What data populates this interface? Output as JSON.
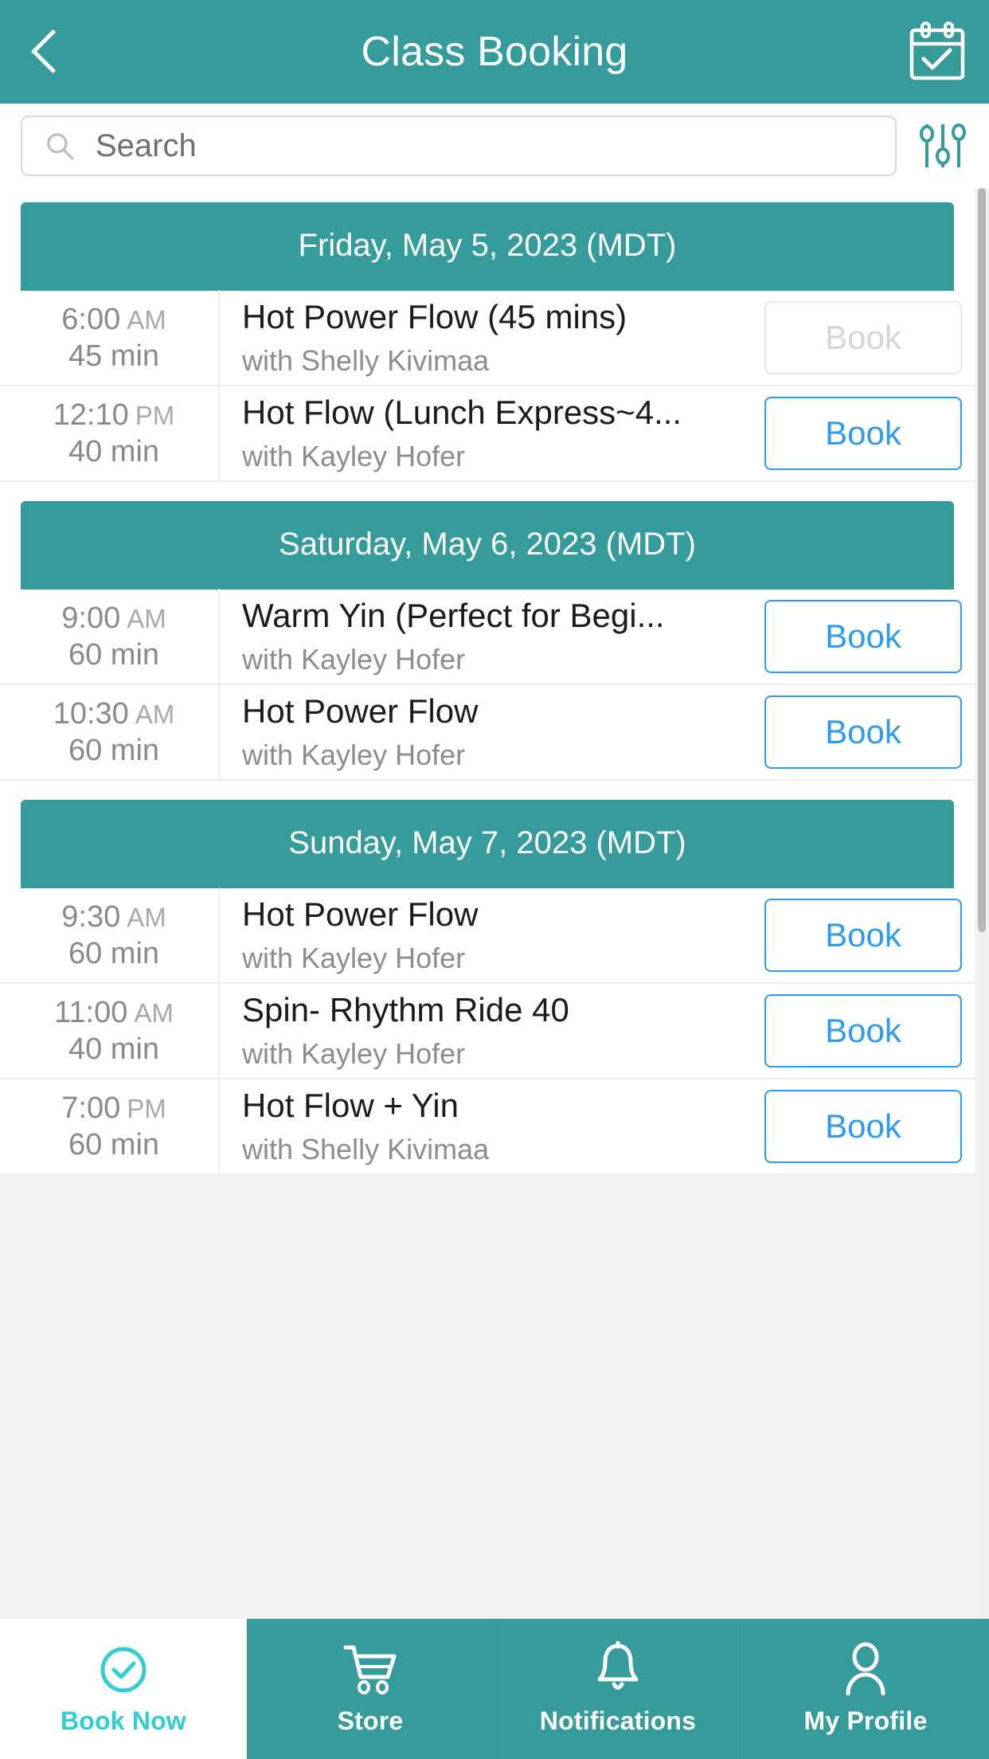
{
  "header": {
    "back_icon": "chevron-left-icon",
    "title": "Class Booking",
    "calendar_icon": "calendar-check-icon",
    "bg_color": "#359b9b"
  },
  "search": {
    "icon": "search-icon",
    "placeholder": "Search",
    "value": "",
    "filter_icon": "filter-sliders-icon",
    "filter_color": "#359b9b"
  },
  "colors": {
    "teal": "#359b9b",
    "book_blue": "#2e9bf0",
    "book_disabled": "#d5d5d5",
    "active_tab": "#32cdd2",
    "page_bg": "#f1f1f1"
  },
  "schedule": [
    {
      "date_label": "Friday, May 5, 2023 (MDT)",
      "classes": [
        {
          "time": "6:00",
          "ampm": "AM",
          "duration": "45 min",
          "name": "Hot Power Flow (45 mins)",
          "teacher": "with Shelly Kivimaa",
          "book_label": "Book",
          "bookable": false
        },
        {
          "time": "12:10",
          "ampm": "PM",
          "duration": "40 min",
          "name": "Hot Flow (Lunch Express~4...",
          "teacher": "with Kayley Hofer",
          "book_label": "Book",
          "bookable": true
        }
      ]
    },
    {
      "date_label": "Saturday, May 6, 2023 (MDT)",
      "classes": [
        {
          "time": "9:00",
          "ampm": "AM",
          "duration": "60 min",
          "name": "Warm Yin (Perfect for Begi...",
          "teacher": "with Kayley Hofer",
          "book_label": "Book",
          "bookable": true
        },
        {
          "time": "10:30",
          "ampm": "AM",
          "duration": "60 min",
          "name": "Hot Power Flow",
          "teacher": "with Kayley Hofer",
          "book_label": "Book",
          "bookable": true
        }
      ]
    },
    {
      "date_label": "Sunday, May 7, 2023 (MDT)",
      "classes": [
        {
          "time": "9:30",
          "ampm": "AM",
          "duration": "60 min",
          "name": "Hot Power Flow",
          "teacher": "with Kayley Hofer",
          "book_label": "Book",
          "bookable": true
        },
        {
          "time": "11:00",
          "ampm": "AM",
          "duration": "40 min",
          "name": "Spin- Rhythm Ride 40",
          "teacher": "with Kayley Hofer",
          "book_label": "Book",
          "bookable": true
        },
        {
          "time": "7:00",
          "ampm": "PM",
          "duration": "60 min",
          "name": "Hot Flow + Yin",
          "teacher": "with Shelly Kivimaa",
          "book_label": "Book",
          "bookable": true
        }
      ]
    }
  ],
  "tabbar": {
    "tabs": [
      {
        "label": "Book Now",
        "icon": "check-circle-icon",
        "active": true
      },
      {
        "label": "Store",
        "icon": "shopping-cart-icon",
        "active": false
      },
      {
        "label": "Notifications",
        "icon": "bell-icon",
        "active": false
      },
      {
        "label": "My Profile",
        "icon": "user-icon",
        "active": false
      }
    ]
  }
}
